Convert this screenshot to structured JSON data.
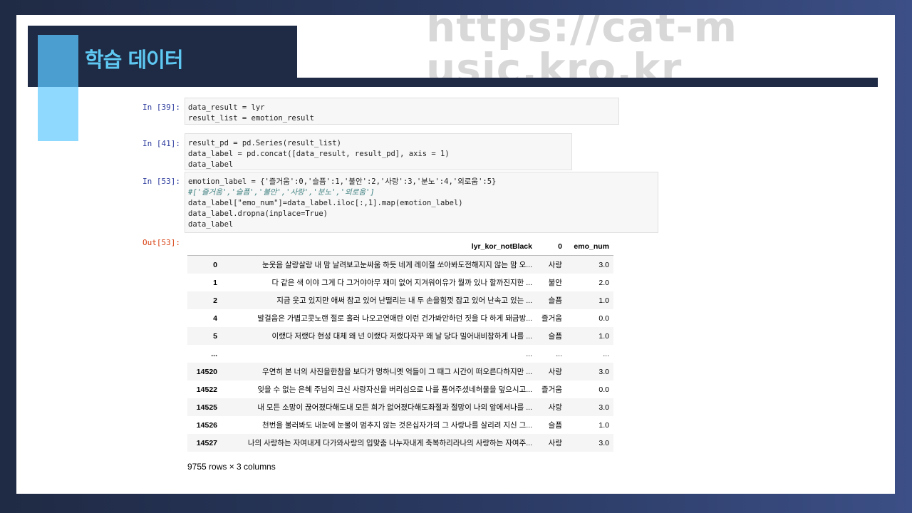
{
  "slide": {
    "title": "학습 데이터",
    "watermark": "https://cat-music.kro.kr"
  },
  "cells": [
    {
      "prompt": "In [39]:",
      "lines": [
        "data_result = lyr",
        "result_list = emotion_result"
      ]
    },
    {
      "prompt": "In [41]:",
      "lines": [
        "result_pd = pd.Series(result_list)",
        "data_label = pd.concat([data_result, result_pd], axis = 1)",
        "data_label"
      ]
    },
    {
      "prompt": "In [53]:",
      "lines": [
        "emotion_label = {'즐거움':0,'슬픔':1,'불안':2,'사랑':3,'분노':4,'외로움':5}",
        "#['즐거움','슬픔','불안','사랑','분노','외로움']",
        "data_label[\"emo_num\"]=data_label.iloc[:,1].map(emotion_label)",
        "data_label.dropna(inplace=True)",
        "data_label"
      ]
    }
  ],
  "output": {
    "prompt": "Out[53]:",
    "columns": [
      "",
      "lyr_kor_notBlack",
      "0",
      "emo_num"
    ],
    "rows": [
      [
        "0",
        "눈웃음 살랑살랑 내 맘 날려보고눈싸움 하듯 네게 레이절 쏘아봐도전해지지 않는 맘 오...",
        "사랑",
        "3.0"
      ],
      [
        "1",
        "다 같은 색 이야 그게 다 그거야아무 재미 없어 지겨워이유가 뭘까 있나 할까진지한 ...",
        "불안",
        "2.0"
      ],
      [
        "2",
        "지금 웃고 있지만 애써 참고 있어 난떨리는 내 두 손을힘껏 잡고 있어 난속고 있는 ...",
        "슬픔",
        "1.0"
      ],
      [
        "4",
        "발걸음은 가볍고콧노랜 절로 흘러 나오고연애란 이런 건가봐안하던 짓을 다 하게 돼금방...",
        "즐거움",
        "0.0"
      ],
      [
        "5",
        "이랬다 저랬다 현성 대체 왜 넌 이랬다 저랬다자꾸 왜 날 당다 밀어내비참하게 나를 ...",
        "슬픔",
        "1.0"
      ],
      [
        "...",
        "...",
        "...",
        "..."
      ],
      [
        "14520",
        "우연히 본 너의 사진을한참을 보다가 멍하니옛 억들이 그 때그 시간이 떠오른다하지만 ...",
        "사랑",
        "3.0"
      ],
      [
        "14522",
        "잊을 수 없는 은혜 주님의 크신 사랑자신을 버리심으로 나를 품어주셨네허물을 덮으시고...",
        "즐거움",
        "0.0"
      ],
      [
        "14525",
        "내 모든 소망이 끊어졌다해도내 모든 희가 없어졌다해도좌절과 절망이 나의 앞에서나를 ...",
        "사랑",
        "3.0"
      ],
      [
        "14526",
        "천번을 불러봐도 내눈에 눈물이 멈추지 않는 것은십자가의 그 사랑나를 살리려 지신 그...",
        "슬픔",
        "1.0"
      ],
      [
        "14527",
        "나의 사랑하는 자여내게 다가와사랑의 입맞춤 나누자내게 축복하리라나의 사랑하는 자여주...",
        "사랑",
        "3.0"
      ]
    ],
    "shape": "9755 rows × 3 columns"
  }
}
